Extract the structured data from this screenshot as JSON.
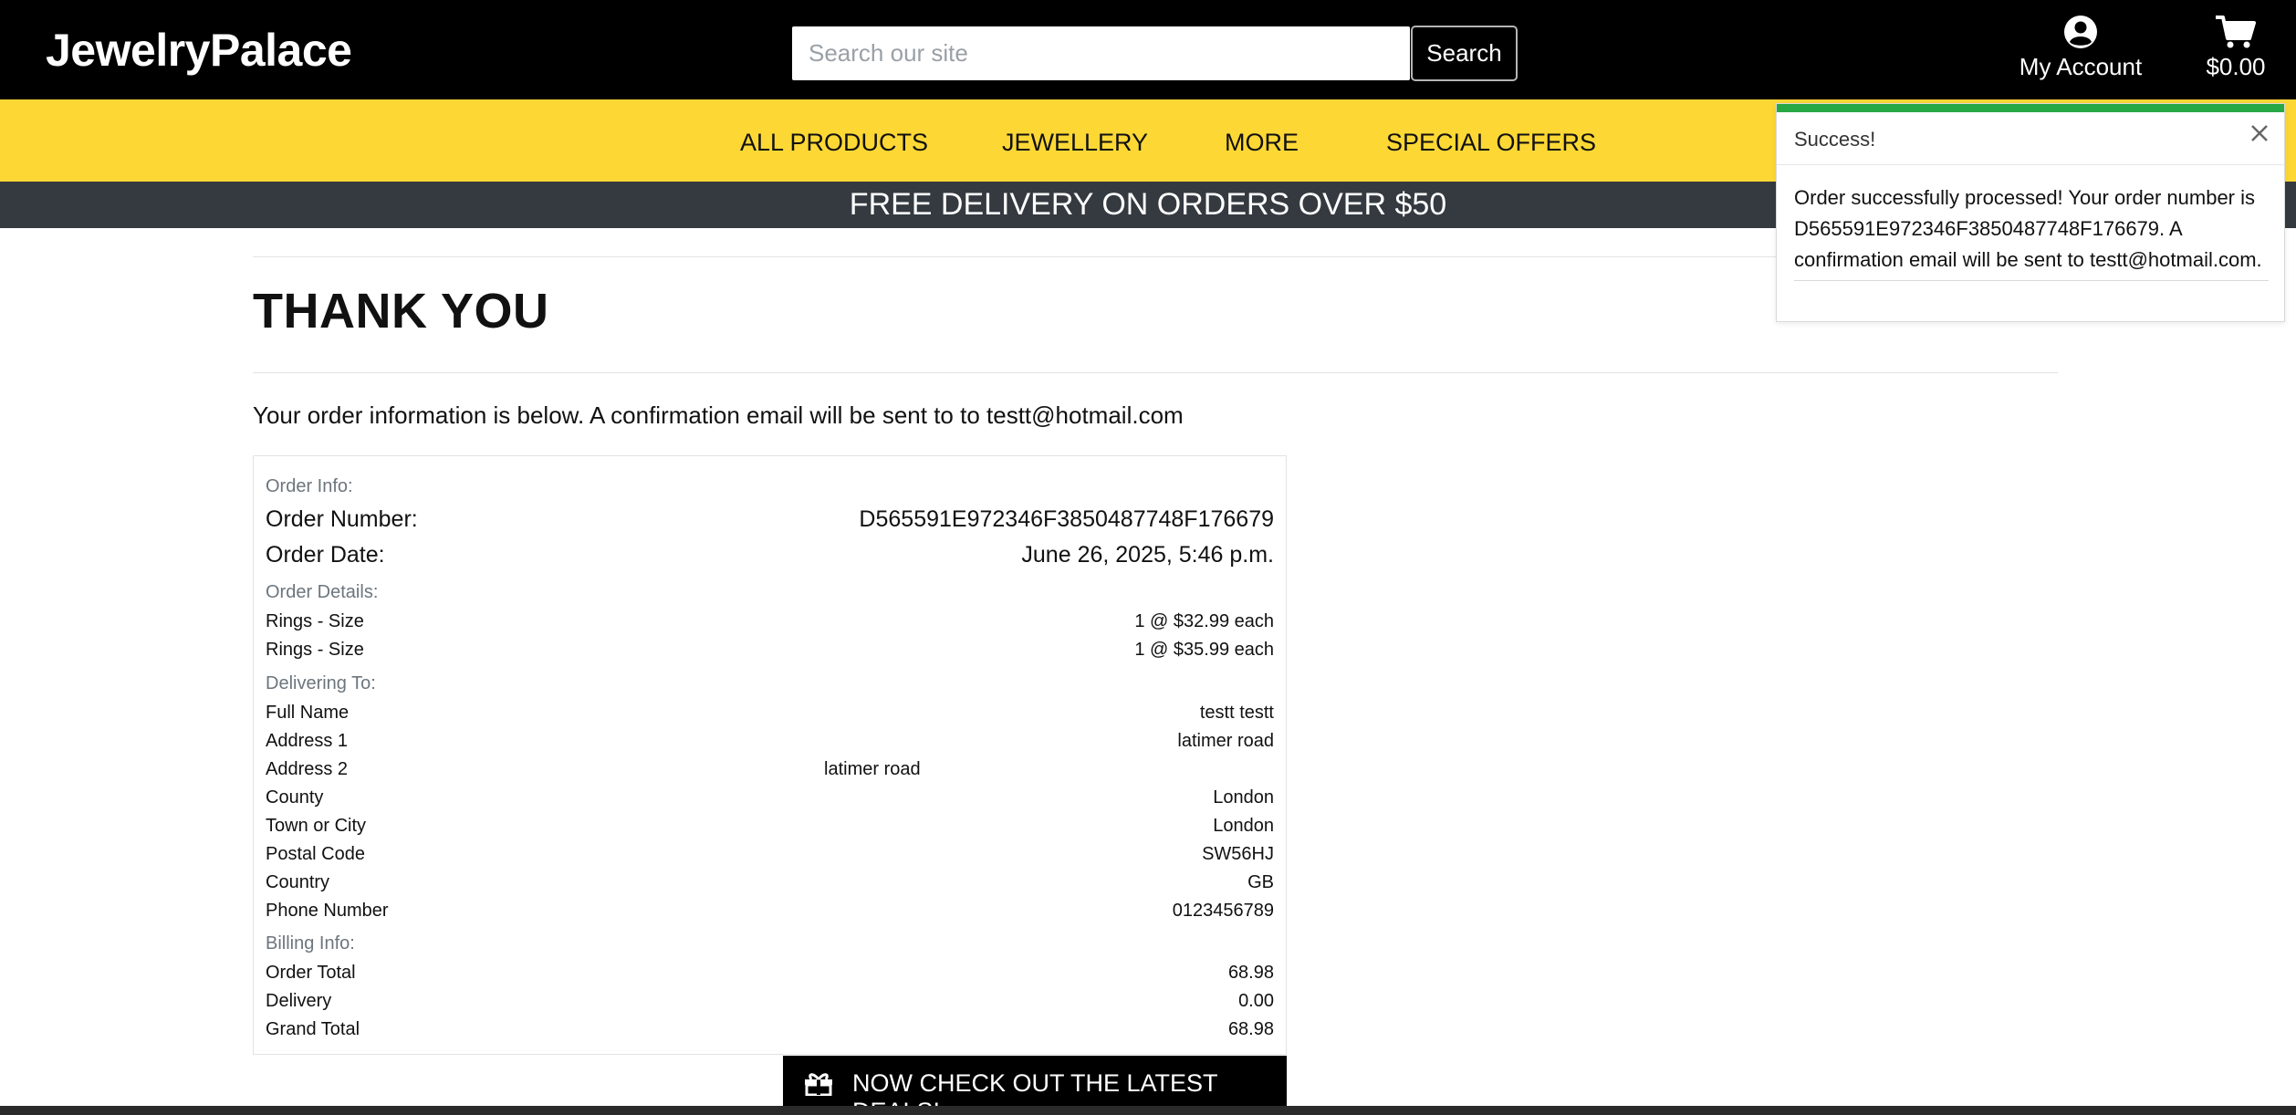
{
  "header": {
    "logo": "JewelryPalace",
    "search_placeholder": "Search our site",
    "search_button": "Search",
    "account_label": "My Account",
    "cart_total": "$0.00"
  },
  "nav": {
    "items": [
      "ALL PRODUCTS",
      "JEWELLERY",
      "MORE",
      "SPECIAL OFFERS"
    ]
  },
  "delivery_banner": "FREE DELIVERY ON ORDERS OVER $50",
  "page": {
    "title": "THANK YOU",
    "intro": "Your order information is below. A confirmation email will be sent to to testt@hotmail.com"
  },
  "order": {
    "info_label": "Order Info:",
    "number_label": "Order Number:",
    "number_value": "D565591E972346F3850487748F176679",
    "date_label": "Order Date:",
    "date_value": "June 26, 2025, 5:46 p.m.",
    "details_label": "Order Details:",
    "items": [
      {
        "name": "Rings - Size",
        "qty_price": "1 @ $32.99 each"
      },
      {
        "name": "Rings - Size",
        "qty_price": "1 @ $35.99 each"
      }
    ],
    "delivering_label": "Delivering To:",
    "delivery": {
      "full_name_label": "Full Name",
      "full_name": "testt testt",
      "address1_label": "Address 1",
      "address1": "latimer road",
      "address2_label": "Address 2",
      "address2": "latimer road",
      "county_label": "County",
      "county": "London",
      "town_label": "Town or City",
      "town": "London",
      "postcode_label": "Postal Code",
      "postcode": "SW56HJ",
      "country_label": "Country",
      "country": "GB",
      "phone_label": "Phone Number",
      "phone": "0123456789"
    },
    "billing_label": "Billing Info:",
    "billing": {
      "order_total_label": "Order Total",
      "order_total": "68.98",
      "delivery_label": "Delivery",
      "delivery": "0.00",
      "grand_total_label": "Grand Total",
      "grand_total": "68.98"
    }
  },
  "deals_banner": "NOW CHECK OUT THE LATEST DEALS!",
  "toast": {
    "title": "Success!",
    "message": "Order successfully processed! Your order number is D565591E972346F3850487748F176679. A confirmation email will be sent to testt@hotmail.com.",
    "accent_color": "#28a745"
  },
  "colors": {
    "header_bg": "#000000",
    "nav_bg": "#fdd835",
    "delivery_bar_bg": "#343a40"
  }
}
